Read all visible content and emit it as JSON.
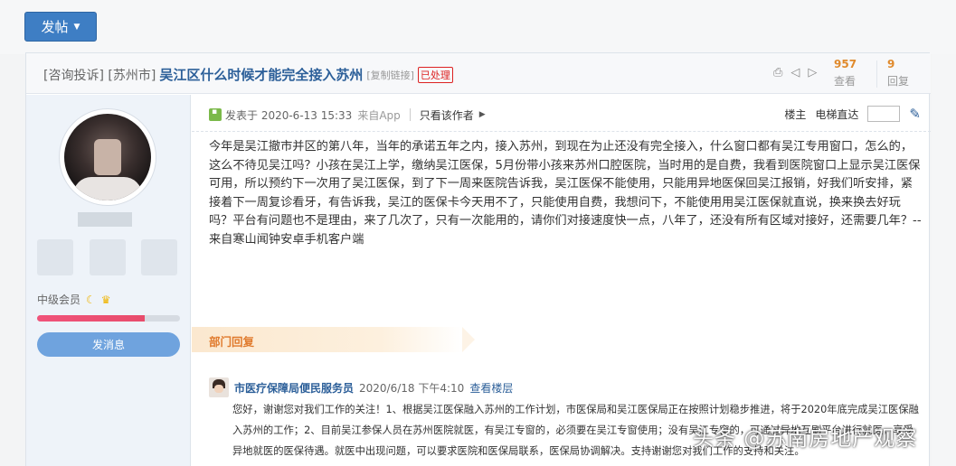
{
  "toolbar": {
    "post_label": "发帖"
  },
  "thread": {
    "prefix": "[咨询投诉] [苏州市]",
    "title": "吴江区什么时候才能完全接入苏州",
    "copy_link": "[复制链接]",
    "status": "已处理",
    "views": "957",
    "views_label": "查看",
    "replies": "9",
    "replies_label": "回复"
  },
  "author": {
    "level": "中级会员",
    "level_progress": 0.75,
    "message_button": "发消息"
  },
  "post": {
    "posted_at": "发表于 2020-6-13 15:33",
    "source": "来自App",
    "only_author": "只看该作者",
    "floor": "楼主",
    "jump_label": "电梯直达",
    "content": "今年是吴江撤市并区的第八年，当年的承诺五年之内，接入苏州，到现在为止还没有完全接入，什么窗口都有吴江专用窗口，怎么的，这么不待见吴江吗？小孩在吴江上学，缴纳吴江医保，5月份带小孩来苏州口腔医院，当时用的是自费，我看到医院窗口上显示吴江医保可用，所以预约下一次用了吴江医保，到了下一周来医院告诉我，吴江医保不能使用，只能用异地医保回吴江报销，好我们听安排，紧接着下一周复诊看牙，有告诉我，吴江的医保卡今天用不了，只能使用自费，我想问下，不能使用用吴江医保就直说，换来换去好玩吗？平台有问题也不是理由，来了几次了，只有一次能用的，请你们对接速度快一点，八年了，还没有所有区域对接好，还需要几年？--来自寒山闻钟安卓手机客户端"
  },
  "reply": {
    "section_label": "部门回复",
    "author": "市医疗保障局便民服务员",
    "time": "2020/6/18 下午4:10",
    "view_floor": "查看楼层",
    "body": "您好，谢谢您对我们工作的关注！1、根据吴江医保融入苏州的工作计划，市医保局和吴江医保局正在按照计划稳步推进，将于2020年底完成吴江医保融入苏州的工作；2、目前吴江参保人员在苏州医院就医，有吴江专窗的，必须要在吴江专窗使用；没有吴江专窗的，可通过异地互刷平台进行就医，享受异地就医的医保待遇。就医中出现问题，可以要求医院和医保局联系，医保局协调解决。支持谢谢您对我们工作的支持和关注。"
  },
  "watermark": "头条 @苏南房地产观察",
  "colors": {
    "accent": "#3e7ec4",
    "title": "#2c5f99",
    "orange": "#e07a2c",
    "status": "#dd2222"
  }
}
